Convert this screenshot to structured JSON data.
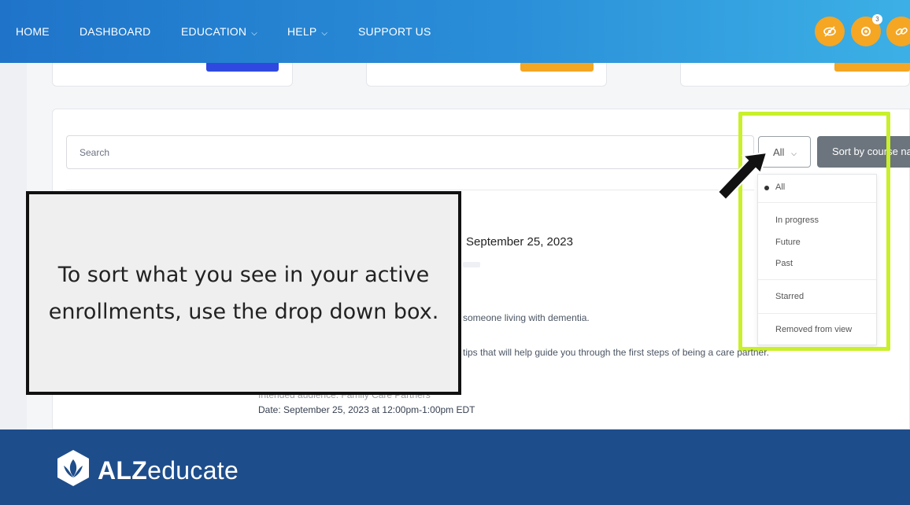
{
  "nav": {
    "home": "HOME",
    "dashboard": "DASHBOARD",
    "education": "EDUCATION",
    "help": "HELP",
    "support": "SUPPORT US",
    "notification_count": "3"
  },
  "colors": {
    "nav_start": "#1f74c9",
    "nav_end": "#3cb0e6",
    "icon_orange": "#f5a623",
    "highlight": "#c9f02b",
    "footer": "#1e4d8b",
    "sort_button": "#6c757d"
  },
  "icons": [
    "eye-slash-icon",
    "gear-bell-icon",
    "link-icon",
    "chevron-down-icon",
    "arrow-pointer-icon",
    "alz-logo-icon"
  ],
  "search": {
    "placeholder": "Search"
  },
  "filter": {
    "selected": "All",
    "sort_label": "Sort by course name",
    "options": [
      "All",
      "In progress",
      "Future",
      "Past",
      "Starred",
      "Removed from view"
    ]
  },
  "course": {
    "date_heading": "September 25, 2023",
    "line1": "someone living with dementia.",
    "line2": "tips that will help guide you through the first steps of being a care partner.",
    "audience": "Intended audience: Family Care Partners",
    "date_line": "Date: September 25, 2023 at 12:00pm-1:00pm EDT"
  },
  "callout": {
    "text": "To sort what you see in your active enrollments, use the drop down box."
  },
  "footer": {
    "brand_bold": "ALZ",
    "brand_light": "educate"
  }
}
